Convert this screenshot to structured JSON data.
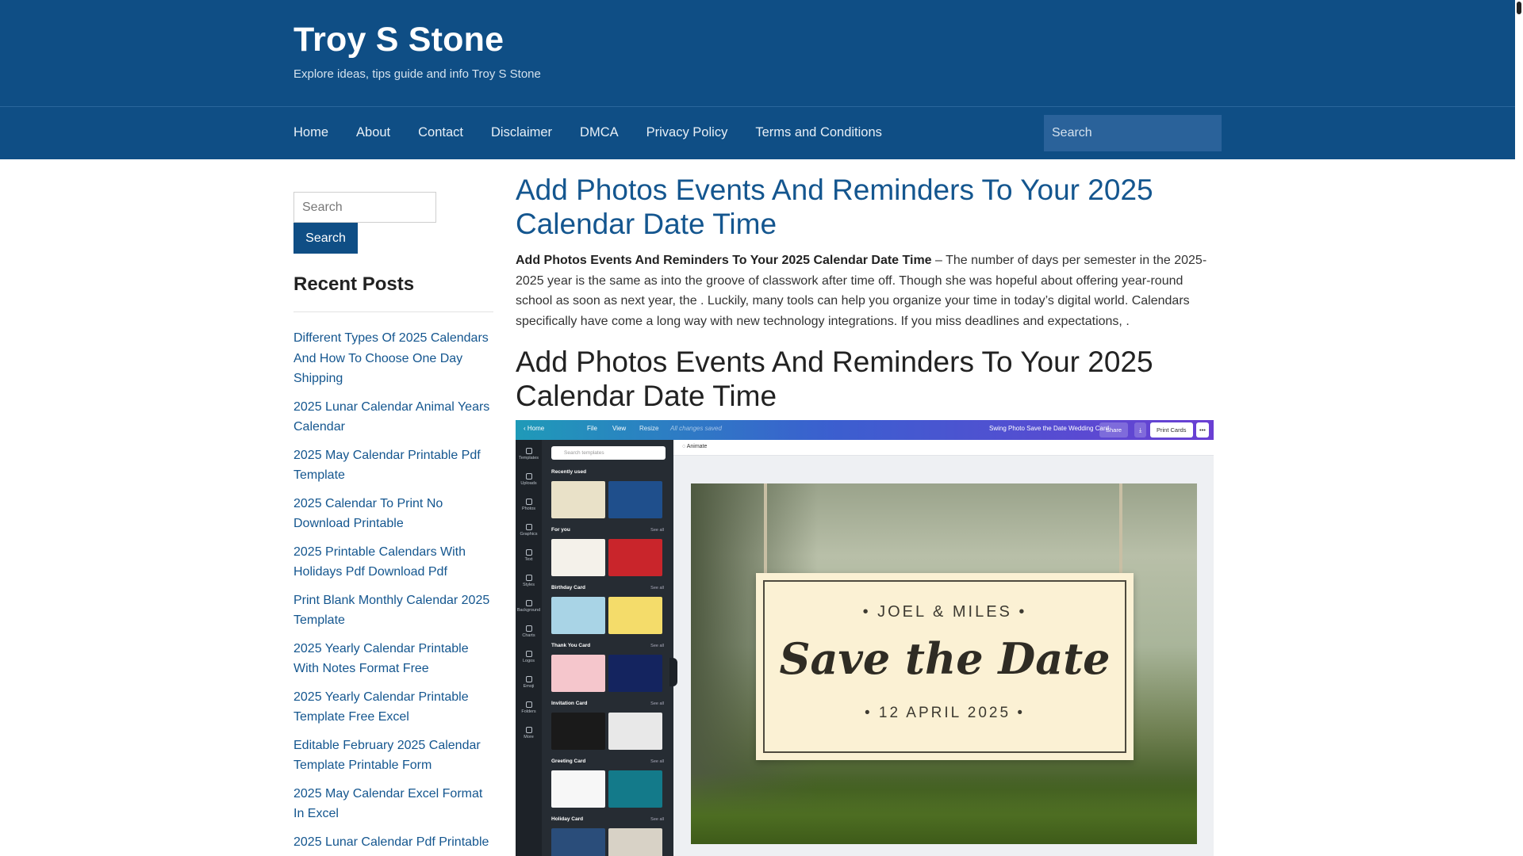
{
  "site": {
    "title": "Troy S Stone",
    "tagline": "Explore ideas, tips guide and info Troy S Stone"
  },
  "nav": {
    "items": [
      "Home",
      "About",
      "Contact",
      "Disclaimer",
      "DMCA",
      "Privacy Policy",
      "Terms and Conditions"
    ],
    "search_placeholder": "Search"
  },
  "sidebar": {
    "search_placeholder": "Search",
    "search_button": "Search",
    "recent_title": "Recent Posts",
    "recent_posts": [
      "Different Types Of 2025 Calendars And How To Choose One Day Shipping",
      "2025 Lunar Calendar Animal Years Calendar",
      "2025 May Calendar Printable Pdf Template",
      "2025 Calendar To Print No Download Printable",
      "2025 Printable Calendars With Holidays Pdf Download Pdf",
      "Print Blank Monthly Calendar 2025 Template",
      "2025 Yearly Calendar Printable With Notes Format Free",
      "2025 Yearly Calendar Printable Template Free Excel",
      "Editable February 2025 Calendar Template Printable Form",
      "2025 May Calendar Excel Format In Excel",
      "2025 Lunar Calendar Pdf Printable"
    ]
  },
  "article": {
    "title": "Add Photos Events And Reminders To Your 2025 Calendar Date Time",
    "intro_bold": "Add Photos Events And Reminders To Your 2025 Calendar Date Time",
    "intro_text": " – The number of days per semester in the 2025-2025 year is the same as into the groove of classwork after time off. Though she was hopeful about offering year-round school as soon as next year, the . Luckily, many tools can help you organize your time in today’s digital world. Calendars specifically have come a long way with new technology integrations. If you miss deadlines and expectations, .",
    "subheading": "Add Photos Events And Reminders To Your 2025 Calendar Date Time"
  },
  "figure": {
    "topbar": {
      "home": "‹ Home",
      "file": "File",
      "view": "View",
      "resize": "Resize",
      "saved": "All changes saved",
      "doc_title": "Swing Photo Save the Date Wedding Card",
      "share": "Share",
      "print": "Print Cards"
    },
    "rail": [
      "Templates",
      "Uploads",
      "Photos",
      "Graphics",
      "Text",
      "Styles",
      "Background",
      "Charts",
      "Logos",
      "Emoji",
      "Folders",
      "More"
    ],
    "panel_search": "Search templates",
    "sections": [
      {
        "label": "Recently used",
        "see_all": ""
      },
      {
        "label": "For you",
        "see_all": "See all"
      },
      {
        "label": "Birthday Card",
        "see_all": "See all"
      },
      {
        "label": "Thank You Card",
        "see_all": "See all"
      },
      {
        "label": "Invitation Card",
        "see_all": "See all"
      },
      {
        "label": "Greeting Card",
        "see_all": "See all"
      },
      {
        "label": "Holiday Card",
        "see_all": "See all"
      }
    ],
    "animate": "Animate",
    "card": {
      "names": "• JOEL & MILES •",
      "headline": "Save the Date",
      "date": "• 12 APRIL 2025 •"
    },
    "colors": {
      "header_bg": "#0f4e85",
      "link": "#14568f"
    }
  }
}
